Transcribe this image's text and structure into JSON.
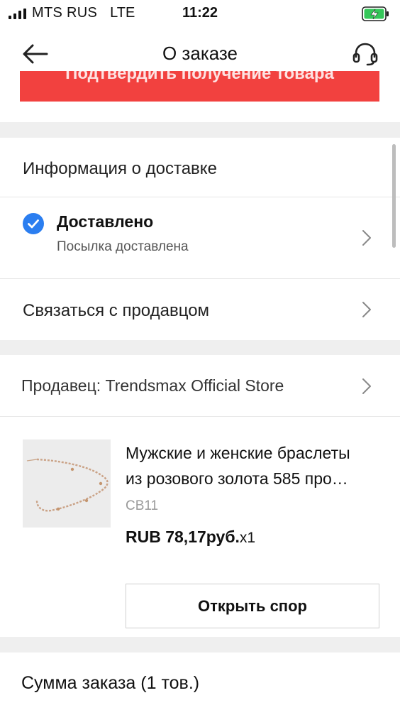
{
  "status_bar": {
    "carrier": "MTS RUS",
    "network": "LTE",
    "time": "11:22"
  },
  "header": {
    "title": "О заказе"
  },
  "banner": {
    "text": "Подтвердить получение товара",
    "color": "#f2413f"
  },
  "delivery_info": {
    "title": "Информация о доставке"
  },
  "delivery_status": {
    "title": "Доставлено",
    "subtitle": "Посылка доставлена",
    "check_color": "#2b7ef0"
  },
  "contact_seller": {
    "label": "Связаться с продавцом"
  },
  "seller": {
    "label": "Продавец: Trendsmax Official Store"
  },
  "product": {
    "title_line1": "Мужские и женские браслеты",
    "title_line2": "из розового золота 585 про…",
    "sku": "CB11",
    "price": "RUB 78,17руб.",
    "quantity": "x1"
  },
  "dispute_button": {
    "label": "Открыть спор"
  },
  "order_sum": {
    "label": "Сумма заказа (1 тов.)"
  }
}
